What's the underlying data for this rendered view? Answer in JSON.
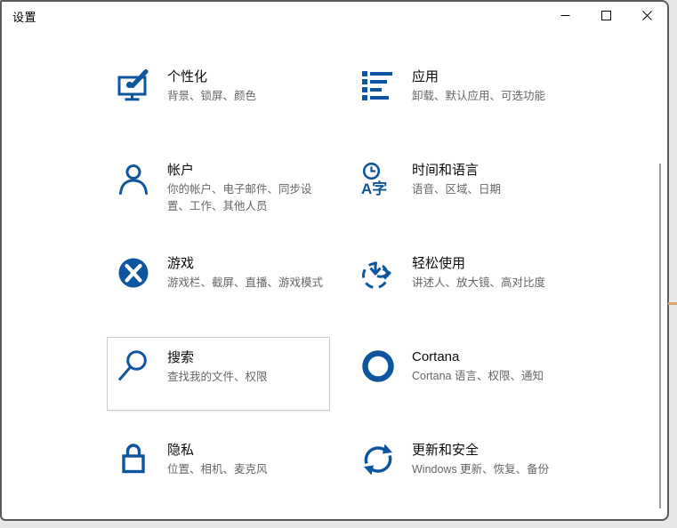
{
  "window": {
    "title": "设置"
  },
  "colors": {
    "icon_blue": "#0d559e",
    "subtitle": "#666666",
    "tile_border": "#cccccc",
    "window_border": "#5a5a5a",
    "backdrop": "#e7e7e7",
    "accent_mark": "#dfa26b"
  },
  "tiles": [
    {
      "id": "personalization",
      "title": "个性化",
      "subtitle": "背景、锁屏、颜色",
      "icon": "personalization-icon",
      "highlighted": false
    },
    {
      "id": "apps",
      "title": "应用",
      "subtitle": "卸载、默认应用、可选功能",
      "icon": "apps-icon",
      "highlighted": false
    },
    {
      "id": "accounts",
      "title": "帐户",
      "subtitle": "你的帐户、电子邮件、同步设\n置、工作、其他人员",
      "icon": "accounts-icon",
      "highlighted": false
    },
    {
      "id": "time-language",
      "title": "时间和语言",
      "subtitle": "语音、区域、日期",
      "icon": "time-language-icon",
      "highlighted": false
    },
    {
      "id": "gaming",
      "title": "游戏",
      "subtitle": "游戏栏、截屏、直播、游戏模式",
      "icon": "gaming-icon",
      "highlighted": false
    },
    {
      "id": "ease-of-access",
      "title": "轻松使用",
      "subtitle": "讲述人、放大镜、高对比度",
      "icon": "ease-of-access-icon",
      "highlighted": false
    },
    {
      "id": "search",
      "title": "搜索",
      "subtitle": "查找我的文件、权限",
      "icon": "search-icon",
      "highlighted": true
    },
    {
      "id": "cortana",
      "title": "Cortana",
      "subtitle": "Cortana 语言、权限、通知",
      "icon": "cortana-icon",
      "highlighted": false
    },
    {
      "id": "privacy",
      "title": "隐私",
      "subtitle": "位置、相机、麦克风",
      "icon": "privacy-icon",
      "highlighted": false
    },
    {
      "id": "update-security",
      "title": "更新和安全",
      "subtitle": "Windows 更新、恢复、备份",
      "icon": "update-security-icon",
      "highlighted": false
    }
  ]
}
